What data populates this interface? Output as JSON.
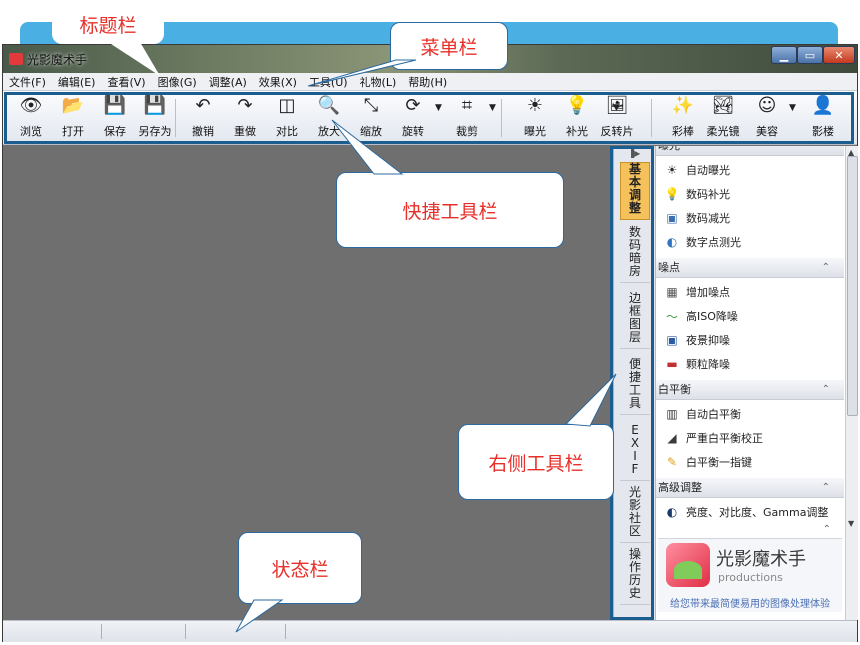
{
  "window": {
    "title": "光影魔术手"
  },
  "menu": [
    "文件(F)",
    "编辑(E)",
    "查看(V)",
    "图像(G)",
    "调整(A)",
    "效果(X)",
    "工具(U)",
    "礼物(L)",
    "帮助(H)"
  ],
  "toolbar": [
    {
      "label": "浏览",
      "icon": "eye-icon",
      "glyph": "👁"
    },
    {
      "label": "打开",
      "icon": "folder-icon",
      "glyph": "📂"
    },
    {
      "label": "保存",
      "icon": "save-icon",
      "glyph": "💾"
    },
    {
      "label": "另存为",
      "icon": "save-as-icon",
      "glyph": "💾"
    },
    {
      "label": "撤销",
      "icon": "undo-icon",
      "glyph": "↶"
    },
    {
      "label": "重做",
      "icon": "redo-icon",
      "glyph": "↷"
    },
    {
      "label": "对比",
      "icon": "compare-icon",
      "glyph": "◫"
    },
    {
      "label": "放大",
      "icon": "zoom-in-icon",
      "glyph": "🔍"
    },
    {
      "label": "缩放",
      "icon": "resize-icon",
      "glyph": "⤡"
    },
    {
      "label": "旋转",
      "icon": "rotate-icon",
      "glyph": "⟳"
    },
    {
      "label": "裁剪",
      "icon": "crop-icon",
      "glyph": "⌗"
    },
    {
      "label": "曝光",
      "icon": "exposure-icon",
      "glyph": "☀"
    },
    {
      "label": "补光",
      "icon": "fill-light-icon",
      "glyph": "💡"
    },
    {
      "label": "反转片",
      "icon": "reversal-film-icon",
      "glyph": "🖼"
    },
    {
      "label": "彩棒",
      "icon": "color-wand-icon",
      "glyph": "✨"
    },
    {
      "label": "柔光镜",
      "icon": "soft-lens-icon",
      "glyph": "🏞"
    },
    {
      "label": "美容",
      "icon": "beauty-icon",
      "glyph": "☺"
    },
    {
      "label": "影楼",
      "icon": "studio-icon",
      "glyph": "👤"
    }
  ],
  "vtabs": [
    "基本调整",
    "数码暗房",
    "边框图层",
    "便捷工具",
    "EXIF",
    "光影社区",
    "操作历史"
  ],
  "panel": {
    "sections": [
      {
        "title": "曝光",
        "items": [
          {
            "label": "自动曝光",
            "glyph": "☀",
            "color": "#2a2a2a"
          },
          {
            "label": "数码补光",
            "glyph": "💡",
            "color": "#d9a21a"
          },
          {
            "label": "数码减光",
            "glyph": "▣",
            "color": "#3a6fb0"
          },
          {
            "label": "数字点测光",
            "glyph": "◐",
            "color": "#2f74c0"
          }
        ]
      },
      {
        "title": "噪点",
        "items": [
          {
            "label": "增加噪点",
            "glyph": "▦",
            "color": "#555555"
          },
          {
            "label": "高ISO降噪",
            "glyph": "〜",
            "color": "#3a9a3a"
          },
          {
            "label": "夜景抑噪",
            "glyph": "▣",
            "color": "#2a5aa0"
          },
          {
            "label": "颗粒降噪",
            "glyph": "▬",
            "color": "#c03030"
          }
        ]
      },
      {
        "title": "白平衡",
        "items": [
          {
            "label": "自动白平衡",
            "glyph": "▥",
            "color": "#3a3a3a"
          },
          {
            "label": "严重白平衡校正",
            "glyph": "◢",
            "color": "#3a3a3a"
          },
          {
            "label": "白平衡一指键",
            "glyph": "✎",
            "color": "#d9a21a"
          }
        ]
      },
      {
        "title": "高级调整",
        "items": [
          {
            "label": "亮度、对比度、Gamma调整",
            "glyph": "◐",
            "color": "#1a3a6a"
          }
        ]
      }
    ]
  },
  "logo": {
    "title": "光影魔术手",
    "subtitle": "productions",
    "slogan": "给您带来最简便易用的图像处理体验"
  },
  "callouts": {
    "title_bar": "标题栏",
    "menu_bar": "菜单栏",
    "quick_toolbar": "快捷工具栏",
    "right_toolbar": "右侧工具栏",
    "status_bar": "状态栏"
  }
}
